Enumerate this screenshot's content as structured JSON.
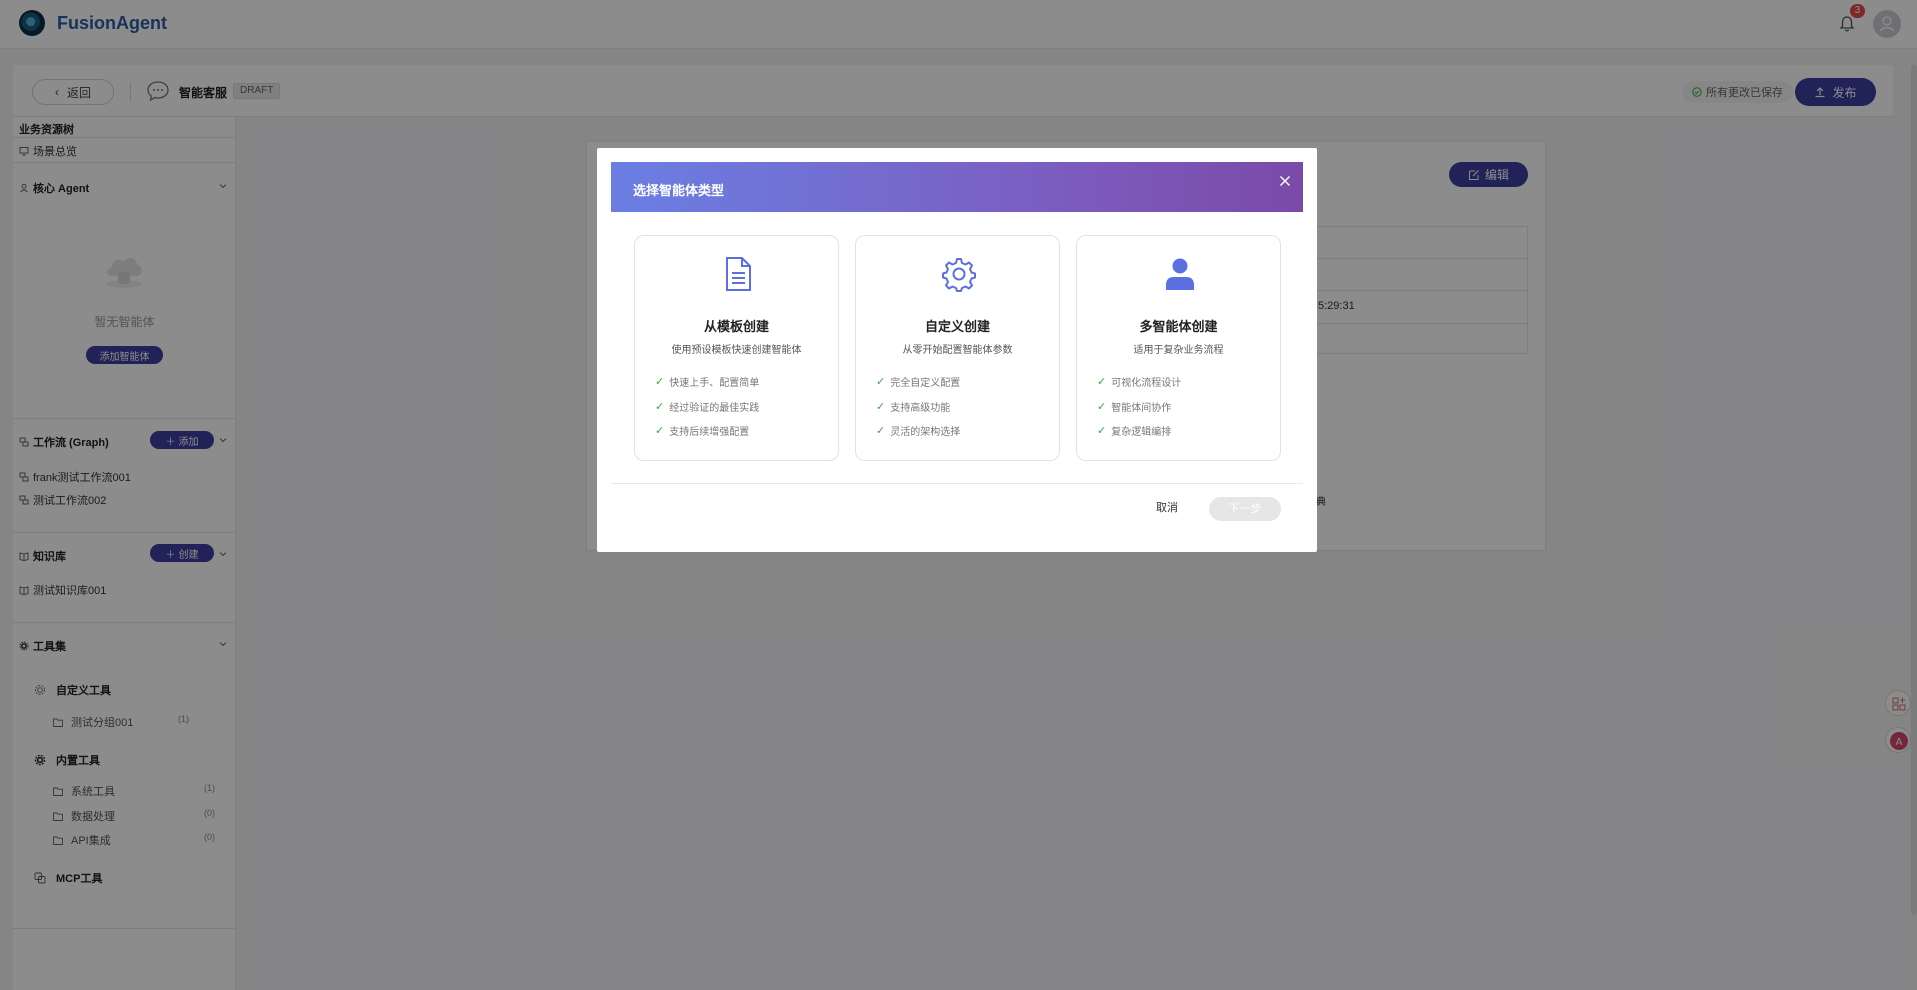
{
  "app": {
    "brand": "FusionAgent",
    "notification_count": "3"
  },
  "header": {
    "back_label": "返回",
    "scene_title": "智能客服",
    "status_tag": "DRAFT",
    "saved_label": "所有更改已保存",
    "publish_label": "发布"
  },
  "sidebar": {
    "resource_tree_title": "业务资源树",
    "overview_label": "场景总览",
    "agent_section": {
      "title": "核心 Agent",
      "empty_text": "暂无智能体",
      "add_label": "添加智能体"
    },
    "workflow_section": {
      "title": "工作流 (Graph)",
      "add_label": "添加",
      "items": [
        "frank测试工作流001",
        "测试工作流002"
      ]
    },
    "knowledge_section": {
      "title": "知识库",
      "create_label": "创建",
      "items": [
        "测试知识库001"
      ]
    },
    "tools_section": {
      "title": "工具集",
      "custom_tools": {
        "title": "自定义工具",
        "items": [
          {
            "label": "测试分组001",
            "count": "(1)"
          }
        ]
      },
      "builtin_tools": {
        "title": "内置工具",
        "items": [
          {
            "label": "系统工具",
            "count": "(1)"
          },
          {
            "label": "数据处理",
            "count": "(0)"
          },
          {
            "label": "API集成",
            "count": "(0)"
          }
        ]
      },
      "mcp_tools": {
        "title": "MCP工具"
      }
    }
  },
  "main": {
    "edit_label": "编辑",
    "time_fragment": "5:29:31",
    "text_fragment": "典"
  },
  "modal": {
    "title": "选择智能体类型",
    "options": [
      {
        "title": "从模板创建",
        "desc": "使用预设模板快速创建智能体",
        "features": [
          "快速上手、配置简单",
          "经过验证的最佳实践",
          "支持后续增强配置"
        ]
      },
      {
        "title": "自定义创建",
        "desc": "从零开始配置智能体参数",
        "features": [
          "完全自定义配置",
          "支持高级功能",
          "灵活的架构选择"
        ]
      },
      {
        "title": "多智能体创建",
        "desc": "适用于复杂业务流程",
        "features": [
          "可视化流程设计",
          "智能体间协作",
          "复杂逻辑编排"
        ]
      }
    ],
    "cancel_label": "取消",
    "next_label": "下一步"
  },
  "colors": {
    "brand": "#2a5da8",
    "primary": "#3d3e9e",
    "modal_header_start": "#6a7fe3",
    "modal_header_end": "#7b4aa8",
    "icon_accent": "#5b6fe0",
    "check": "#3aa845"
  }
}
